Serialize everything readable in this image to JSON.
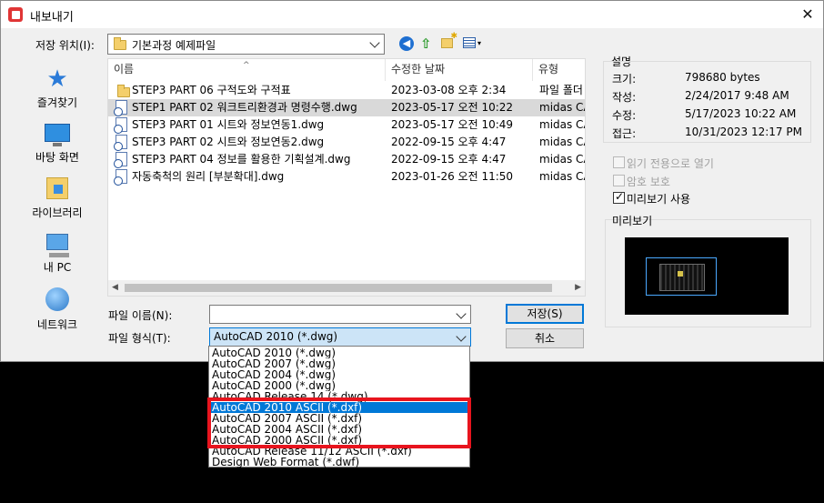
{
  "window": {
    "title": "내보내기",
    "close_glyph": "✕"
  },
  "location": {
    "label": "저장 위치(I):",
    "value": "기본과정 예제파일"
  },
  "toolbar": {
    "back_glyph": "◀",
    "up_glyph": "⇧",
    "views_caret": "▾"
  },
  "sidebar": {
    "items": [
      {
        "label": "즐겨찾기",
        "icon": "star-icon"
      },
      {
        "label": "바탕 화면",
        "icon": "desktop-icon"
      },
      {
        "label": "라이브러리",
        "icon": "library-icon"
      },
      {
        "label": "내 PC",
        "icon": "computer-icon"
      },
      {
        "label": "네트워크",
        "icon": "network-icon"
      }
    ]
  },
  "filelist": {
    "sort_glyph": "^",
    "columns": {
      "name": "이름",
      "date": "수정한 날짜",
      "type": "유형"
    },
    "rows": [
      {
        "name": "STEP3 PART 06 구적도와 구적표",
        "date": "2023-03-08 오후 2:34",
        "type": "파일 폴더",
        "kind": "folder"
      },
      {
        "name": "STEP1 PART 02 워크트리환경과 명령수행.dwg",
        "date": "2023-05-17 오전 10:22",
        "type": "midas CA",
        "kind": "dwg"
      },
      {
        "name": "STEP3 PART 01 시트와 정보연동1.dwg",
        "date": "2023-05-17 오전 10:49",
        "type": "midas CA",
        "kind": "dwg"
      },
      {
        "name": "STEP3 PART 02 시트와 정보연동2.dwg",
        "date": "2022-09-15 오후 4:47",
        "type": "midas CA",
        "kind": "dwg"
      },
      {
        "name": "STEP3 PART 04 정보를 활용한 기획설계.dwg",
        "date": "2022-09-15 오후 4:47",
        "type": "midas CA",
        "kind": "dwg"
      },
      {
        "name": "자동축척의 원리 [부분확대].dwg",
        "date": "2023-01-26 오전 11:50",
        "type": "midas CA",
        "kind": "dwg"
      }
    ],
    "selected_index": 1,
    "scroll_left_glyph": "◀",
    "scroll_right_glyph": "▶"
  },
  "filename": {
    "label": "파일 이름(N):",
    "value": ""
  },
  "filetype": {
    "label": "파일 형식(T):",
    "value": "AutoCAD 2010 (*.dwg)",
    "options": [
      "AutoCAD 2010 (*.dwg)",
      "AutoCAD 2007 (*.dwg)",
      "AutoCAD 2004 (*.dwg)",
      "AutoCAD 2000 (*.dwg)",
      "AutoCAD Release 14 (*.dwg)",
      "AutoCAD 2010 ASCII (*.dxf)",
      "AutoCAD 2007 ASCII (*.dxf)",
      "AutoCAD 2004 ASCII (*.dxf)",
      "AutoCAD 2000 ASCII (*.dxf)",
      "AutoCAD Release 11/12 ASCII (*.dxf)",
      "Design Web Format (*.dwf)"
    ],
    "highlighted_index": 5
  },
  "buttons": {
    "save": "저장(S)",
    "cancel": "취소"
  },
  "info": {
    "title": "설명",
    "rows": [
      {
        "key": "크기:",
        "value": "798680 bytes"
      },
      {
        "key": "작성:",
        "value": "2/24/2017 9:48 AM"
      },
      {
        "key": "수정:",
        "value": "5/17/2023 10:22 AM"
      },
      {
        "key": "접근:",
        "value": "10/31/2023 12:17 PM"
      }
    ]
  },
  "options": {
    "readonly": {
      "label": "읽기 전용으로 열기",
      "checked": false,
      "enabled": false
    },
    "password": {
      "label": "암호 보호",
      "checked": false,
      "enabled": false
    },
    "preview": {
      "label": "미리보기 사용",
      "checked": true,
      "enabled": true
    }
  },
  "preview": {
    "title": "미리보기"
  },
  "colors": {
    "accent": "#0078d7",
    "highlight_annotation": "#e8141e",
    "selection_row": "#d9d9d9"
  }
}
